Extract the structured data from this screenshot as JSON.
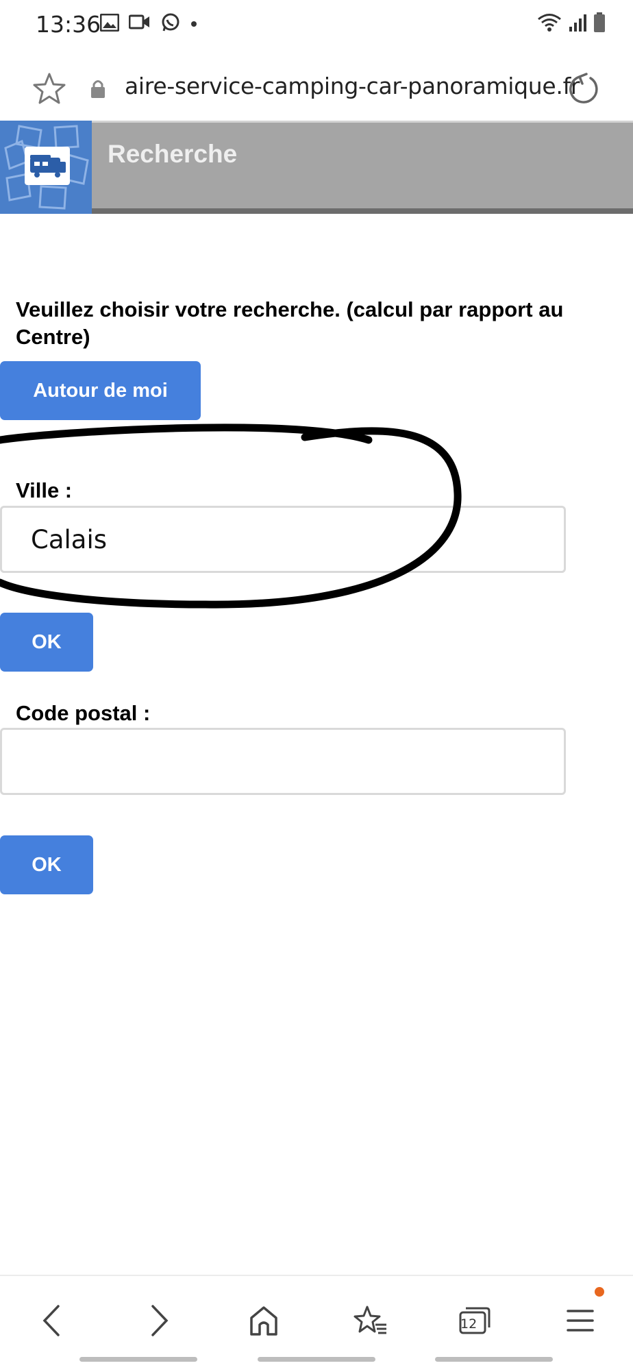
{
  "status_bar": {
    "time": "13:36",
    "left_icons": [
      "image-icon",
      "video-call-icon",
      "whatsapp-icon",
      "dot-icon"
    ],
    "right_icons": [
      "wifi-icon",
      "signal-icon",
      "battery-icon"
    ]
  },
  "browser": {
    "url": "aire-service-camping-car-panoramique.fr",
    "tab_count": "12"
  },
  "header": {
    "title": "Recherche"
  },
  "main": {
    "instruction": "Veuillez choisir votre recherche. (calcul par rapport au Centre)",
    "around_me_label": "Autour de moi",
    "city_label": "Ville :",
    "city_value": "Calais",
    "ok_label": "OK",
    "postal_label": "Code postal :",
    "postal_value": ""
  },
  "colors": {
    "button": "#4580dd",
    "header_bg": "#a5a5a5",
    "logo_bg": "#4a7fc9",
    "notification_dot": "#e8671f"
  }
}
